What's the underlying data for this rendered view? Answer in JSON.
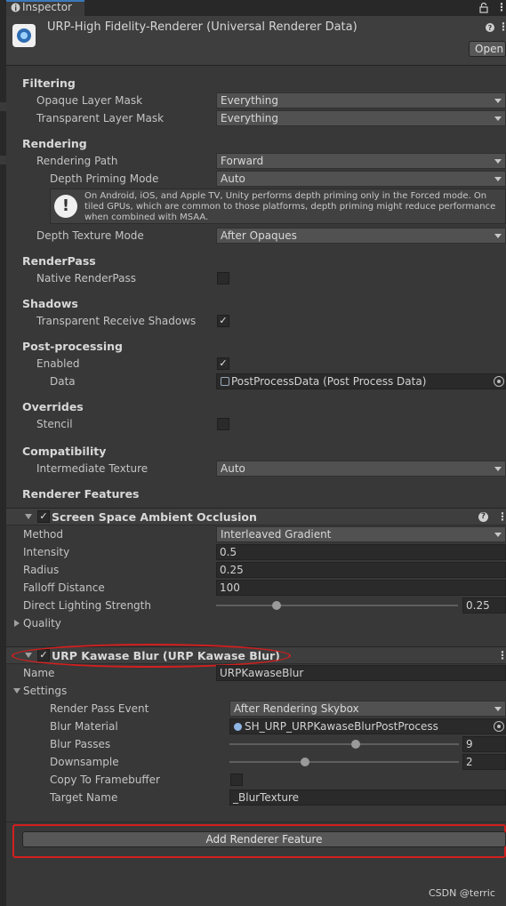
{
  "tab": {
    "label": "Inspector"
  },
  "header": {
    "title": "URP-High Fidelity-Renderer (Universal Renderer Data)",
    "open_label": "Open"
  },
  "sections": {
    "filtering": "Filtering",
    "rendering": "Rendering",
    "renderpass": "RenderPass",
    "shadows": "Shadows",
    "postprocessing": "Post-processing",
    "overrides": "Overrides",
    "compatibility": "Compatibility",
    "renderer_features": "Renderer Features"
  },
  "fields": {
    "opaque_layer_mask": {
      "label": "Opaque Layer Mask",
      "value": "Everything"
    },
    "transparent_layer_mask": {
      "label": "Transparent Layer Mask",
      "value": "Everything"
    },
    "rendering_path": {
      "label": "Rendering Path",
      "value": "Forward"
    },
    "depth_priming_mode": {
      "label": "Depth Priming Mode",
      "value": "Auto"
    },
    "depth_priming_help": "On Android, iOS, and Apple TV, Unity performs depth priming only in the Forced mode. On tiled GPUs, which are common to those platforms, depth priming might reduce performance when combined with MSAA.",
    "depth_texture_mode": {
      "label": "Depth Texture Mode",
      "value": "After Opaques"
    },
    "native_renderpass": {
      "label": "Native RenderPass",
      "checked": false
    },
    "transparent_receive_shadows": {
      "label": "Transparent Receive Shadows",
      "checked": true
    },
    "pp_enabled": {
      "label": "Enabled",
      "checked": true
    },
    "pp_data": {
      "label": "Data",
      "value": "PostProcessData (Post Process Data)"
    },
    "stencil": {
      "label": "Stencil",
      "checked": false
    },
    "intermediate_texture": {
      "label": "Intermediate Texture",
      "value": "Auto"
    }
  },
  "ssao": {
    "title": "Screen Space Ambient Occlusion",
    "enabled": true,
    "method": {
      "label": "Method",
      "value": "Interleaved Gradient"
    },
    "intensity": {
      "label": "Intensity",
      "value": "0.5"
    },
    "radius": {
      "label": "Radius",
      "value": "0.25"
    },
    "falloff": {
      "label": "Falloff Distance",
      "value": "100"
    },
    "direct_lighting": {
      "label": "Direct Lighting Strength",
      "value": "0.25",
      "fraction": 0.25
    },
    "quality": "Quality"
  },
  "kawase": {
    "title": "URP Kawase Blur (URP Kawase Blur)",
    "enabled": true,
    "name": {
      "label": "Name",
      "value": "URPKawaseBlur"
    },
    "settings": "Settings",
    "render_pass_event": {
      "label": "Render Pass Event",
      "value": "After Rendering Skybox"
    },
    "blur_material": {
      "label": "Blur Material",
      "value": "SH_URP_URPKawaseBlurPostProcess"
    },
    "blur_passes": {
      "label": "Blur Passes",
      "value": "9",
      "fraction": 0.55
    },
    "downsample": {
      "label": "Downsample",
      "value": "2",
      "fraction": 0.33
    },
    "copy_to_framebuffer": {
      "label": "Copy To Framebuffer",
      "checked": false
    },
    "target_name": {
      "label": "Target Name",
      "value": "_BlurTexture"
    }
  },
  "add_feature": "Add Renderer Feature",
  "watermark": "CSDN @terric",
  "colors": {
    "highlight": "#d21f1f",
    "accent": "#3a79bb",
    "background": "#383838"
  },
  "icons": {
    "help": "help-icon",
    "lock": "lock-icon",
    "menu": "kebab-menu-icon",
    "info": "info-icon",
    "picker": "object-picker-icon"
  }
}
